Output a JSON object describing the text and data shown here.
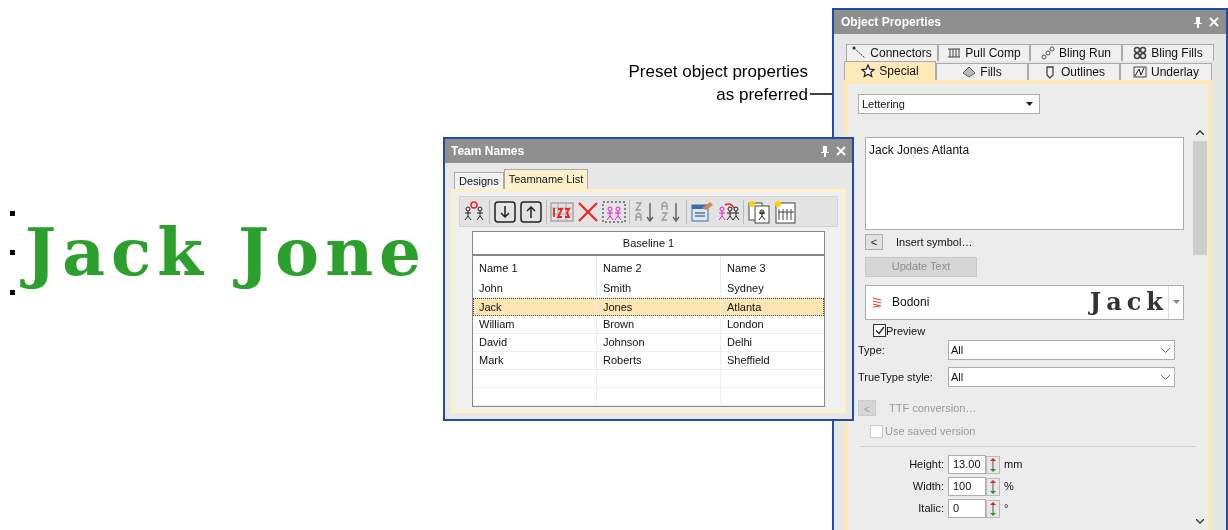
{
  "canvas": {
    "lettering": "Jack Jone"
  },
  "annotation": {
    "text": "Preset object properties as preferred"
  },
  "team_names": {
    "title": "Team Names",
    "tabs": [
      {
        "label": "Designs",
        "selected": false
      },
      {
        "label": "Teamname List",
        "selected": true
      }
    ],
    "table": {
      "group_header": "Baseline 1",
      "columns": [
        "Name 1",
        "Name 2",
        "Name 3"
      ],
      "rows": [
        {
          "cells": [
            "John",
            "Smith",
            "Sydney"
          ],
          "selected": false
        },
        {
          "cells": [
            "Jack",
            "Jones",
            "Atlanta"
          ],
          "selected": true
        },
        {
          "cells": [
            "William",
            "Brown",
            "London"
          ],
          "selected": false
        },
        {
          "cells": [
            "David",
            "Johnson",
            "Delhi"
          ],
          "selected": false
        },
        {
          "cells": [
            "Mark",
            "Roberts",
            "Sheffield"
          ],
          "selected": false
        }
      ]
    }
  },
  "object_properties": {
    "title": "Object Properties",
    "tabs_back": [
      {
        "label": "Connectors",
        "kind": "connectors",
        "selected": false
      },
      {
        "label": "Pull Comp",
        "kind": "pullcomp",
        "selected": false
      },
      {
        "label": "Bling Run",
        "kind": "blingrun",
        "selected": false
      },
      {
        "label": "Bling Fills",
        "kind": "blingfills",
        "selected": false
      }
    ],
    "tabs_front": [
      {
        "label": "Special",
        "kind": "special",
        "selected": true
      },
      {
        "label": "Fills",
        "kind": "fills",
        "selected": false
      },
      {
        "label": "Outlines",
        "kind": "outlines",
        "selected": false
      },
      {
        "label": "Underlay",
        "kind": "underlay",
        "selected": false
      }
    ],
    "object_type": "Lettering",
    "text": "Jack Jones Atlanta",
    "insert_symbol": {
      "button": "<",
      "label": "Insert symbol…"
    },
    "update_button": {
      "label": "Update Text",
      "disabled": true
    },
    "font": {
      "name": "Bodoni",
      "sample": "Jack"
    },
    "preview": {
      "label": "Preview",
      "checked": true
    },
    "type": {
      "label": "Type:",
      "value": "All"
    },
    "truetype_style": {
      "label": "TrueType style:",
      "value": "All"
    },
    "ttf_conversion": {
      "button": "<",
      "label": "TTF conversion…",
      "disabled": true
    },
    "use_saved_version": {
      "label": "Use saved version",
      "checked": false,
      "disabled": true
    },
    "fields": [
      {
        "label": "Height:",
        "value": "13.00",
        "unit": "mm"
      },
      {
        "label": "Width:",
        "value": "100",
        "unit": "%"
      },
      {
        "label": "Italic:",
        "value": "0",
        "unit": "°"
      }
    ]
  }
}
